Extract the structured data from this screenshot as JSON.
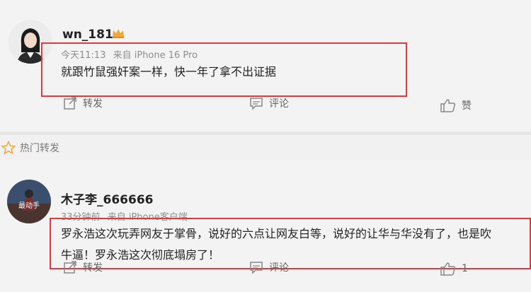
{
  "posts": [
    {
      "username": "wn_181",
      "time": "今天11:13",
      "source": "来自 iPhone 16 Pro",
      "content": [
        "就跟竹鼠强奸案一样，快一年了拿不出证据"
      ],
      "actions": {
        "repost": "转发",
        "comment": "评论",
        "like": "赞"
      }
    },
    {
      "username": "木子李_666666",
      "avatar_text": "最动手",
      "time": "33分钟前",
      "source": "来自 iPhone客户端",
      "content": [
        "罗永浩这次玩弄网友于掌骨，说好的六点让网友白等，说好的让华与华没有了，也是吹",
        "牛逼！罗永浩这次彻底塌房了！"
      ],
      "actions": {
        "repost": "转发",
        "comment": "评论",
        "like": "1"
      }
    }
  ],
  "section": {
    "hot_reposts": "热门转发"
  },
  "colors": {
    "highlight_border": "#e0393e",
    "badge": "#f0a83a"
  }
}
